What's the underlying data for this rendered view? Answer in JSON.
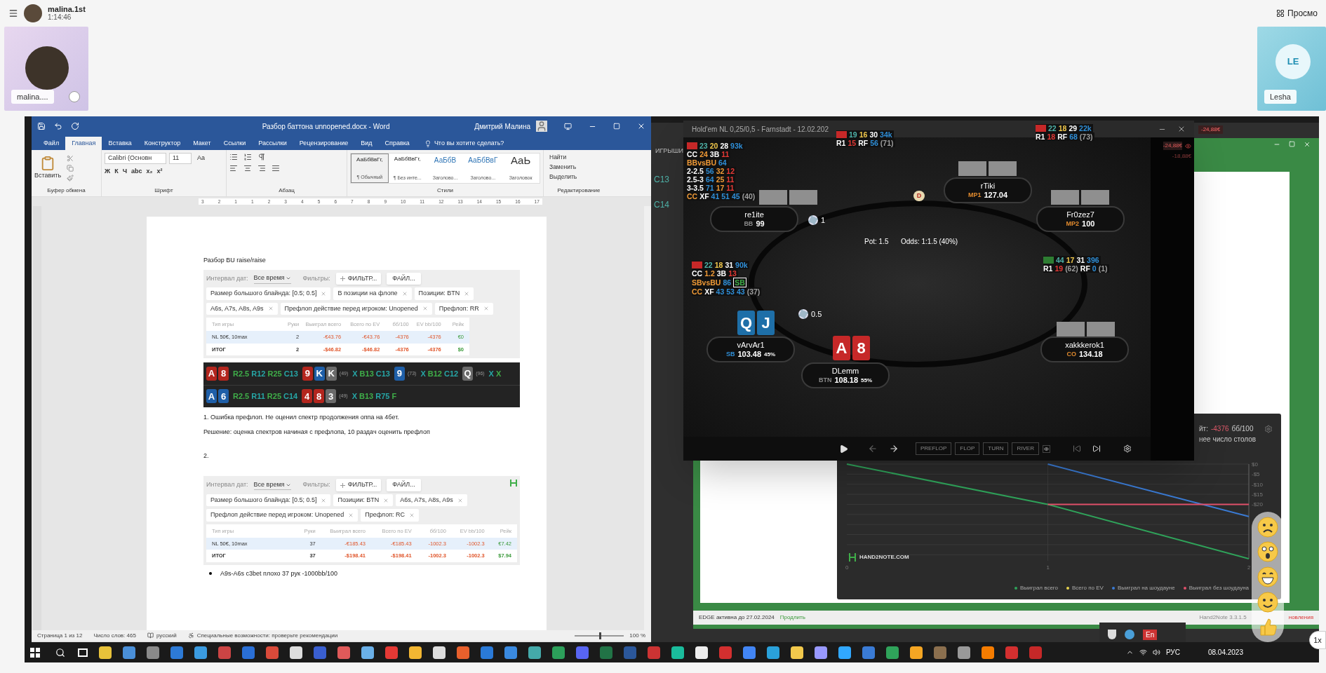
{
  "call": {
    "title": "malina.1st",
    "time": "1:14:46",
    "view_button": "Просмо",
    "tiles": [
      {
        "kind": "photo",
        "label": "malina...."
      },
      {
        "kind": "initials",
        "initials": "LE",
        "label": "Lesha"
      }
    ]
  },
  "word": {
    "title": "Разбор баттона unnopened.docx  -  Word",
    "user": "Дмитрий Малина",
    "tabs": [
      {
        "label": "Файл",
        "selected": false
      },
      {
        "label": "Главная",
        "selected": true
      },
      {
        "label": "Вставка",
        "selected": false
      },
      {
        "label": "Конструктор",
        "selected": false
      },
      {
        "label": "Макет",
        "selected": false
      },
      {
        "label": "Ссылки",
        "selected": false
      },
      {
        "label": "Рассылки",
        "selected": false
      },
      {
        "label": "Рецензирование",
        "selected": false
      },
      {
        "label": "Вид",
        "selected": false
      },
      {
        "label": "Справка",
        "selected": false
      }
    ],
    "tell_me": "Что вы хотите сделать?",
    "ribbon": {
      "paste": "Вставить",
      "font": "Calibri (Основн",
      "size": "11",
      "case": "Аа",
      "format": [
        "Ж",
        "К",
        "Ч",
        "abc",
        "x₂",
        "x²"
      ],
      "styles": [
        {
          "kind": "normal",
          "sample": "АаБбВвГг,",
          "name": "¶ Обычный",
          "selected": true
        },
        {
          "kind": "normal",
          "sample": "АаБбВвГг,",
          "name": "¶ Без инте...",
          "selected": false
        },
        {
          "kind": "heading",
          "sample": "АаБбВ",
          "name": "Заголово...",
          "selected": false
        },
        {
          "kind": "heading",
          "sample": "АаБбВвГ",
          "name": "Заголово...",
          "selected": false
        },
        {
          "kind": "title",
          "sample": "АаЬ",
          "name": "Заголовок",
          "selected": false
        }
      ],
      "editing": [
        "Найти",
        "Заменить",
        "Выделить"
      ],
      "groups": [
        "Буфер обмена",
        "Шрифт",
        "Абзац",
        "Стили",
        "Редактирование"
      ]
    },
    "ruler": [
      "3",
      "2",
      "1",
      "1",
      "2",
      "3",
      "4",
      "5",
      "6",
      "7",
      "8",
      "9",
      "10",
      "11",
      "12",
      "13",
      "14",
      "15",
      "16",
      "17"
    ],
    "heading": "Разбор BU raise/raise",
    "blocks": [
      {
        "kind": "filters",
        "logo": false,
        "date_label": "Интервал дат:",
        "date_value": "Все время",
        "filters_label": "Фильтры:",
        "add_button": "ФИЛЬТР...",
        "file_button": "ФАЙЛ...",
        "chips": [
          "Размер большого блайнда: [0.5; 0.5]",
          "В позиции на флопе",
          "Позиции: BTN",
          "A6s, A7s, A8s, A9s",
          "Префлоп действие перед игроком: Unopened",
          "Префлоп: RR"
        ],
        "columns": [
          "Тип игры",
          "Руки",
          "Выиграл всего",
          "Всего по EV",
          "бб/100",
          "EV bb/100",
          "Рейк"
        ],
        "rows": [
          {
            "kind": "game",
            "cells": [
              "NL 50€, 10max",
              "2",
              "-€43.76",
              "-€43.76",
              "-4376",
              "-4376",
              "€0"
            ]
          },
          {
            "kind": "total",
            "cells": [
              "ИТОГ",
              "2",
              "-$46.82",
              "-$46.82",
              "-4376",
              "-4376",
              "$0"
            ]
          }
        ]
      },
      {
        "kind": "hands",
        "rows": [
          {
            "segments": [
              {
                "kind": "cards",
                "cards": [
                  {
                    "rank": "A",
                    "color": "#b3261e"
                  },
                  {
                    "rank": "8",
                    "color": "#b3261e"
                  }
                ]
              },
              {
                "kind": "actions",
                "actions": [
                  {
                    "text": "R2.5",
                    "color": "#3fae49"
                  },
                  {
                    "text": "R12",
                    "color": "#26a6a6"
                  },
                  {
                    "text": "R25",
                    "color": "#3fae49"
                  },
                  {
                    "text": "C13",
                    "color": "#26a6a6"
                  }
                ]
              },
              {
                "kind": "cards",
                "note": "(49)",
                "cards": [
                  {
                    "rank": "9",
                    "color": "#b3261e"
                  },
                  {
                    "rank": "K",
                    "color": "#1f5fa8"
                  },
                  {
                    "rank": "K",
                    "color": "#6b6b6b"
                  }
                ]
              },
              {
                "kind": "actions",
                "actions": [
                  {
                    "text": "X",
                    "color": "#26a6a6"
                  },
                  {
                    "text": "B13",
                    "color": "#3fae49"
                  },
                  {
                    "text": "C13",
                    "color": "#26a6a6"
                  }
                ]
              },
              {
                "kind": "cards",
                "note": "(73)",
                "cards": [
                  {
                    "rank": "9",
                    "color": "#1f5fa8"
                  }
                ]
              },
              {
                "kind": "actions",
                "actions": [
                  {
                    "text": "X",
                    "color": "#26a6a6"
                  },
                  {
                    "text": "B12",
                    "color": "#3fae49"
                  },
                  {
                    "text": "C12",
                    "color": "#26a6a6"
                  }
                ]
              },
              {
                "kind": "cards",
                "note": "(96)",
                "cards": [
                  {
                    "rank": "Q",
                    "color": "#6b6b6b"
                  }
                ]
              },
              {
                "kind": "actions",
                "actions": [
                  {
                    "text": "X",
                    "color": "#26a6a6"
                  },
                  {
                    "text": "X",
                    "color": "#3fae49"
                  }
                ]
              }
            ]
          },
          {
            "segments": [
              {
                "kind": "cards",
                "cards": [
                  {
                    "rank": "A",
                    "color": "#1f5fa8"
                  },
                  {
                    "rank": "6",
                    "color": "#1f5fa8"
                  }
                ]
              },
              {
                "kind": "actions",
                "actions": [
                  {
                    "text": "R2.5",
                    "color": "#3fae49"
                  },
                  {
                    "text": "R11",
                    "color": "#26a6a6"
                  },
                  {
                    "text": "R25",
                    "color": "#3fae49"
                  },
                  {
                    "text": "C14",
                    "color": "#26a6a6"
                  }
                ]
              },
              {
                "kind": "cards",
                "note": "(49)",
                "cards": [
                  {
                    "rank": "4",
                    "color": "#b3261e"
                  },
                  {
                    "rank": "8",
                    "color": "#b3261e"
                  },
                  {
                    "rank": "3",
                    "color": "#6b6b6b"
                  }
                ]
              },
              {
                "kind": "actions",
                "actions": [
                  {
                    "text": "X",
                    "color": "#26a6a6"
                  },
                  {
                    "text": "B13",
                    "color": "#3fae49"
                  },
                  {
                    "text": "R75",
                    "color": "#26a6a6"
                  },
                  {
                    "text": "F",
                    "color": "#3fae49"
                  }
                ]
              }
            ]
          }
        ]
      },
      {
        "kind": "para",
        "text": "1. Ошибка префлоп. Не оценил спектр продолжения оппа на 4бет."
      },
      {
        "kind": "para",
        "text": "Решение: оценка спектров начиная с префлопа, 10 раздач оценить префлоп"
      },
      {
        "kind": "number",
        "text": "2."
      },
      {
        "kind": "filters",
        "logo": true,
        "date_label": "Интервал дат:",
        "date_value": "Все время",
        "filters_label": "Фильтры:",
        "add_button": "ФИЛЬТР...",
        "file_button": "ФАЙЛ...",
        "chips": [
          "Размер большого блайнда: [0.5; 0.5]",
          "Позиции: BTN",
          "A6s, A7s, A8s, A9s",
          "Префлоп действие перед игроком: Unopened",
          "Префлоп: RC"
        ],
        "columns": [
          "Тип игры",
          "Руки",
          "Выиграл всего",
          "Всего по EV",
          "бб/100",
          "EV bb/100",
          "Рейк"
        ],
        "rows": [
          {
            "kind": "game",
            "cells": [
              "NL 50€, 10max",
              "37",
              "-€185.43",
              "-€185.43",
              "-1002.3",
              "-1002.3",
              "€7.42"
            ]
          },
          {
            "kind": "total",
            "cells": [
              "ИТОГ",
              "37",
              "-$198.41",
              "-$198.41",
              "-1002.3",
              "-1002.3",
              "$7.94"
            ]
          }
        ]
      },
      {
        "kind": "bullet",
        "text": "A9s-A6s c3bet плохо 37 рук -1000bb/100"
      }
    ],
    "status": [
      "Страница 1 из 12",
      "Число слов: 465",
      "русский",
      "Специальные возможности: проверьте рекомендации"
    ],
    "zoom": "100 %",
    "zoom_slider": {
      "level": 0.5
    }
  },
  "poker": {
    "title": "Hold'em NL 0,25/0,5 - Farnstadt - 12.02.202",
    "pot": "Pot:  1.5",
    "odds": "Odds:  1:1.5 (40%)",
    "dealer": "D",
    "seats": [
      {
        "name": "rTiki",
        "position": "MP1",
        "color": "#e08a2e",
        "stack": "127.04",
        "face_down": true
      },
      {
        "name": "re1ite",
        "position": "BB",
        "color": "#8a8a8a",
        "stack": "99",
        "face_down": true
      },
      {
        "name": "Fr0zez7",
        "position": "MP2",
        "color": "#e08a2e",
        "stack": "100",
        "face_down": true
      },
      {
        "name": "vArvAr1",
        "position": "SB",
        "color": "#2f8fd8",
        "stack": "103.48",
        "equity": "45%",
        "face_down": false,
        "cards": [
          {
            "rank": "Q",
            "color": "#1e6fa8"
          },
          {
            "rank": "J",
            "color": "#1e6fa8"
          }
        ]
      },
      {
        "name": "DLemm",
        "position": "BTN",
        "color": "#8a8a8a",
        "stack": "108.18",
        "equity": "55%",
        "face_down": false,
        "cards": [
          {
            "rank": "A",
            "color": "#c62828"
          },
          {
            "rank": "8",
            "color": "#c62828"
          }
        ]
      },
      {
        "name": "xakkkerok1",
        "position": "CO",
        "color": "#e08a2e",
        "stack": "134.18",
        "face_down": true
      }
    ],
    "bets": [
      "1",
      "0.5"
    ],
    "huds": [
      [
        [
          {
            "kind": "box",
            "color": "#c62828"
          },
          {
            "kind": "text",
            "text": "22",
            "color": "#4fb3a9"
          },
          {
            "kind": "text",
            "text": "18",
            "color": "#f2c94c"
          },
          {
            "kind": "text",
            "text": "29",
            "color": "#ffffff"
          },
          {
            "kind": "text",
            "text": "22k",
            "color": "#2f8fd8"
          }
        ],
        [
          {
            "kind": "text",
            "text": "R1",
            "color": "#ffffff"
          },
          {
            "kind": "text",
            "text": "18",
            "color": "#e53935"
          },
          {
            "kind": "text",
            "text": "RF",
            "color": "#ffffff"
          },
          {
            "kind": "text",
            "text": "68",
            "color": "#2f8fd8"
          },
          {
            "kind": "text",
            "text": "(73)",
            "color": "#9e9e9e"
          }
        ]
      ],
      [
        [
          {
            "kind": "box",
            "color": "#c62828"
          },
          {
            "kind": "text",
            "text": "19",
            "color": "#4fb3a9"
          },
          {
            "kind": "text",
            "text": "16",
            "color": "#f2c94c"
          },
          {
            "kind": "text",
            "text": "30",
            "color": "#ffffff"
          },
          {
            "kind": "text",
            "text": "34k",
            "color": "#2f8fd8"
          }
        ],
        [
          {
            "kind": "text",
            "text": "R1",
            "color": "#ffffff"
          },
          {
            "kind": "text",
            "text": "15",
            "color": "#e53935"
          },
          {
            "kind": "text",
            "text": "RF",
            "color": "#ffffff"
          },
          {
            "kind": "text",
            "text": "56",
            "color": "#2f8fd8"
          },
          {
            "kind": "text",
            "text": "(71)",
            "color": "#9e9e9e"
          }
        ]
      ],
      [
        [
          {
            "kind": "box",
            "color": "#c62828"
          },
          {
            "kind": "text",
            "text": "23",
            "color": "#4fb3a9"
          },
          {
            "kind": "text",
            "text": "20",
            "color": "#f2c94c"
          },
          {
            "kind": "text",
            "text": "28",
            "color": "#ffffff"
          },
          {
            "kind": "text",
            "text": "93k",
            "color": "#2f8fd8"
          }
        ],
        [
          {
            "kind": "text",
            "text": "CC",
            "color": "#ffffff"
          },
          {
            "kind": "text",
            "text": "24",
            "color": "#f09a36"
          },
          {
            "kind": "text",
            "text": "3B",
            "color": "#ffffff"
          },
          {
            "kind": "text",
            "text": "11",
            "color": "#e53935"
          }
        ],
        [
          {
            "kind": "text",
            "text": "BBvsBU",
            "color": "#f09a36"
          },
          {
            "kind": "text",
            "text": "64",
            "color": "#2f8fd8"
          }
        ],
        [
          {
            "kind": "text",
            "text": "2-2.5",
            "color": "#ffffff"
          },
          {
            "kind": "text",
            "text": "56",
            "color": "#2f8fd8"
          },
          {
            "kind": "text",
            "text": "32",
            "color": "#f09a36"
          },
          {
            "kind": "text",
            "text": "12",
            "color": "#e53935"
          }
        ],
        [
          {
            "kind": "text",
            "text": "2.5-3",
            "color": "#ffffff"
          },
          {
            "kind": "text",
            "text": "64",
            "color": "#2f8fd8"
          },
          {
            "kind": "text",
            "text": "25",
            "color": "#f09a36"
          },
          {
            "kind": "text",
            "text": "11",
            "color": "#e53935"
          }
        ],
        [
          {
            "kind": "text",
            "text": "3-3.5",
            "color": "#ffffff"
          },
          {
            "kind": "text",
            "text": "71",
            "color": "#2f8fd8"
          },
          {
            "kind": "text",
            "text": "17",
            "color": "#f09a36"
          },
          {
            "kind": "text",
            "text": "11",
            "color": "#e53935"
          }
        ],
        [
          {
            "kind": "text",
            "text": "CC",
            "color": "#f09a36"
          },
          {
            "kind": "text",
            "text": "XF",
            "color": "#ffffff"
          },
          {
            "kind": "text",
            "text": "41",
            "color": "#2f8fd8"
          },
          {
            "kind": "text",
            "text": "51",
            "color": "#2f8fd8"
          },
          {
            "kind": "text",
            "text": "45",
            "color": "#2f8fd8"
          },
          {
            "kind": "text",
            "text": "(40)",
            "color": "#9e9e9e"
          }
        ]
      ],
      [
        [
          {
            "kind": "box",
            "color": "#2e7d32"
          },
          {
            "kind": "text",
            "text": "44",
            "color": "#4fb3a9"
          },
          {
            "kind": "text",
            "text": "17",
            "color": "#f2c94c"
          },
          {
            "kind": "text",
            "text": "31",
            "color": "#ffffff"
          },
          {
            "kind": "text",
            "text": "396",
            "color": "#2f8fd8"
          }
        ],
        [
          {
            "kind": "text",
            "text": "R1",
            "color": "#ffffff"
          },
          {
            "kind": "text",
            "text": "19",
            "color": "#e53935"
          },
          {
            "kind": "text",
            "text": "(62)",
            "color": "#9e9e9e"
          },
          {
            "kind": "text",
            "text": "RF",
            "color": "#ffffff"
          },
          {
            "kind": "text",
            "text": "0",
            "color": "#2f8fd8"
          },
          {
            "kind": "text",
            "text": "(1)",
            "color": "#9e9e9e"
          }
        ]
      ],
      [
        [
          {
            "kind": "box",
            "color": "#c62828"
          },
          {
            "kind": "text",
            "text": "22",
            "color": "#4fb3a9"
          },
          {
            "kind": "text",
            "text": "18",
            "color": "#f2c94c"
          },
          {
            "kind": "text",
            "text": "31",
            "color": "#ffffff"
          },
          {
            "kind": "text",
            "text": "90k",
            "color": "#2f8fd8"
          }
        ],
        [
          {
            "kind": "text",
            "text": "CC",
            "color": "#ffffff"
          },
          {
            "kind": "text",
            "text": "1.2",
            "color": "#f09a36"
          },
          {
            "kind": "text",
            "text": "3B",
            "color": "#ffffff"
          },
          {
            "kind": "text",
            "text": "13",
            "color": "#e53935"
          }
        ],
        [
          {
            "kind": "text",
            "text": "SBvsBU",
            "color": "#f09a36"
          },
          {
            "kind": "text",
            "text": "86",
            "color": "#2f8fd8"
          },
          {
            "kind": "framed",
            "text": "SB",
            "color": "#3fae49"
          }
        ],
        [
          {
            "kind": "text",
            "text": "CC",
            "color": "#f09a36"
          },
          {
            "kind": "text",
            "text": "XF",
            "color": "#ffffff"
          },
          {
            "kind": "text",
            "text": "43",
            "color": "#2f8fd8"
          },
          {
            "kind": "text",
            "text": "53",
            "color": "#2f8fd8"
          },
          {
            "kind": "text",
            "text": "43",
            "color": "#2f8fd8"
          },
          {
            "kind": "text",
            "text": "(37)",
            "color": "#9e9e9e"
          }
        ]
      ]
    ],
    "streets": [
      "PREFLOP",
      "FLOP",
      "TURN",
      "RIVER"
    ],
    "side_values": [
      "-24,88€",
      "-18,88€"
    ]
  },
  "h2n": {
    "left_labels": [
      "ИГРЫШИ",
      "C13",
      "C14"
    ],
    "top_value": "-24,88€",
    "chart_header": {
      "prefix": "йт:",
      "value": "-4376",
      "unit": "бб/100",
      "subtitle": "нее число столов"
    },
    "logo": "HAND2NOTE.COM",
    "chart_data": {
      "type": "line",
      "x": [
        0,
        1,
        2
      ],
      "xlim": [
        0,
        2
      ],
      "xticks": [
        0,
        1,
        2
      ],
      "ylim": [
        -47,
        0
      ],
      "grid": true,
      "legend": "bottom-right",
      "yticks": [
        {
          "value": 0,
          "label": "$0"
        },
        {
          "value": -5,
          "label": "-$5"
        },
        {
          "value": -10,
          "label": "-$10"
        },
        {
          "value": -15,
          "label": "-$15"
        },
        {
          "value": -20,
          "label": "-$20"
        }
      ],
      "series": [
        {
          "name": "Выиграл всего",
          "color": "#2fa35a",
          "values": [
            0,
            -20,
            -47
          ]
        },
        {
          "name": "Всего по EV",
          "color": "#e8d44d",
          "values": [
            null,
            null,
            null
          ]
        },
        {
          "name": "Выиграл на шоудауне",
          "color": "#3a7bd5",
          "values": [
            null,
            0,
            -26
          ]
        },
        {
          "name": "Выиграл без шоудауна",
          "color": "#e0506a",
          "values": [
            null,
            -20,
            -20
          ]
        }
      ]
    },
    "status": {
      "license": "EDGE активна до 27.02.2024",
      "renew": "Продлить",
      "version": "Hand2Note 3.3.1.5",
      "update": "новления"
    }
  },
  "taskbar": {
    "apps": [
      {
        "color": "#e8c23a"
      },
      {
        "color": "#4a8fd8"
      },
      {
        "color": "#8a8a8a"
      },
      {
        "color": "#2d7ad6"
      },
      {
        "color": "#3b9be0"
      },
      {
        "color": "#cc4444"
      },
      {
        "color": "#2a6fd6"
      },
      {
        "color": "#d94a3a"
      },
      {
        "color": "#dddddd"
      },
      {
        "color": "#3a5fd0"
      },
      {
        "color": "#e05a5a"
      },
      {
        "color": "#6ab0e8"
      },
      {
        "color": "#e53935"
      },
      {
        "color": "#f2b632"
      },
      {
        "color": "#dddddd"
      },
      {
        "color": "#e8602c"
      },
      {
        "color": "#2a7ad8"
      },
      {
        "color": "#3a8ae0"
      },
      {
        "color": "#44aaaa"
      },
      {
        "color": "#2c9f5a"
      },
      {
        "color": "#5865f2"
      },
      {
        "color": "#217346"
      },
      {
        "color": "#2b579a"
      },
      {
        "color": "#cc3333"
      },
      {
        "color": "#1abc9c"
      },
      {
        "color": "#eeeeee"
      },
      {
        "color": "#d32f2f"
      },
      {
        "color": "#4285f4"
      },
      {
        "color": "#2aa1da"
      },
      {
        "color": "#f2c94c"
      },
      {
        "color": "#9999ff"
      },
      {
        "color": "#31a8ff"
      },
      {
        "color": "#3a7bd5"
      },
      {
        "color": "#2fa35a"
      },
      {
        "color": "#f5a623"
      },
      {
        "color": "#8b6f4e"
      },
      {
        "color": "#999999"
      },
      {
        "color": "#f57c00"
      },
      {
        "color": "#d32f2f"
      },
      {
        "color": "#c62828"
      }
    ],
    "language": "РУС",
    "date": "08.04.2023",
    "popup_label": "En"
  },
  "reactions": [
    {
      "kind": "sad"
    },
    {
      "kind": "surprised"
    },
    {
      "kind": "grin"
    },
    {
      "kind": "smile"
    },
    {
      "kind": "thumbs"
    }
  ],
  "speed_button": "1x"
}
